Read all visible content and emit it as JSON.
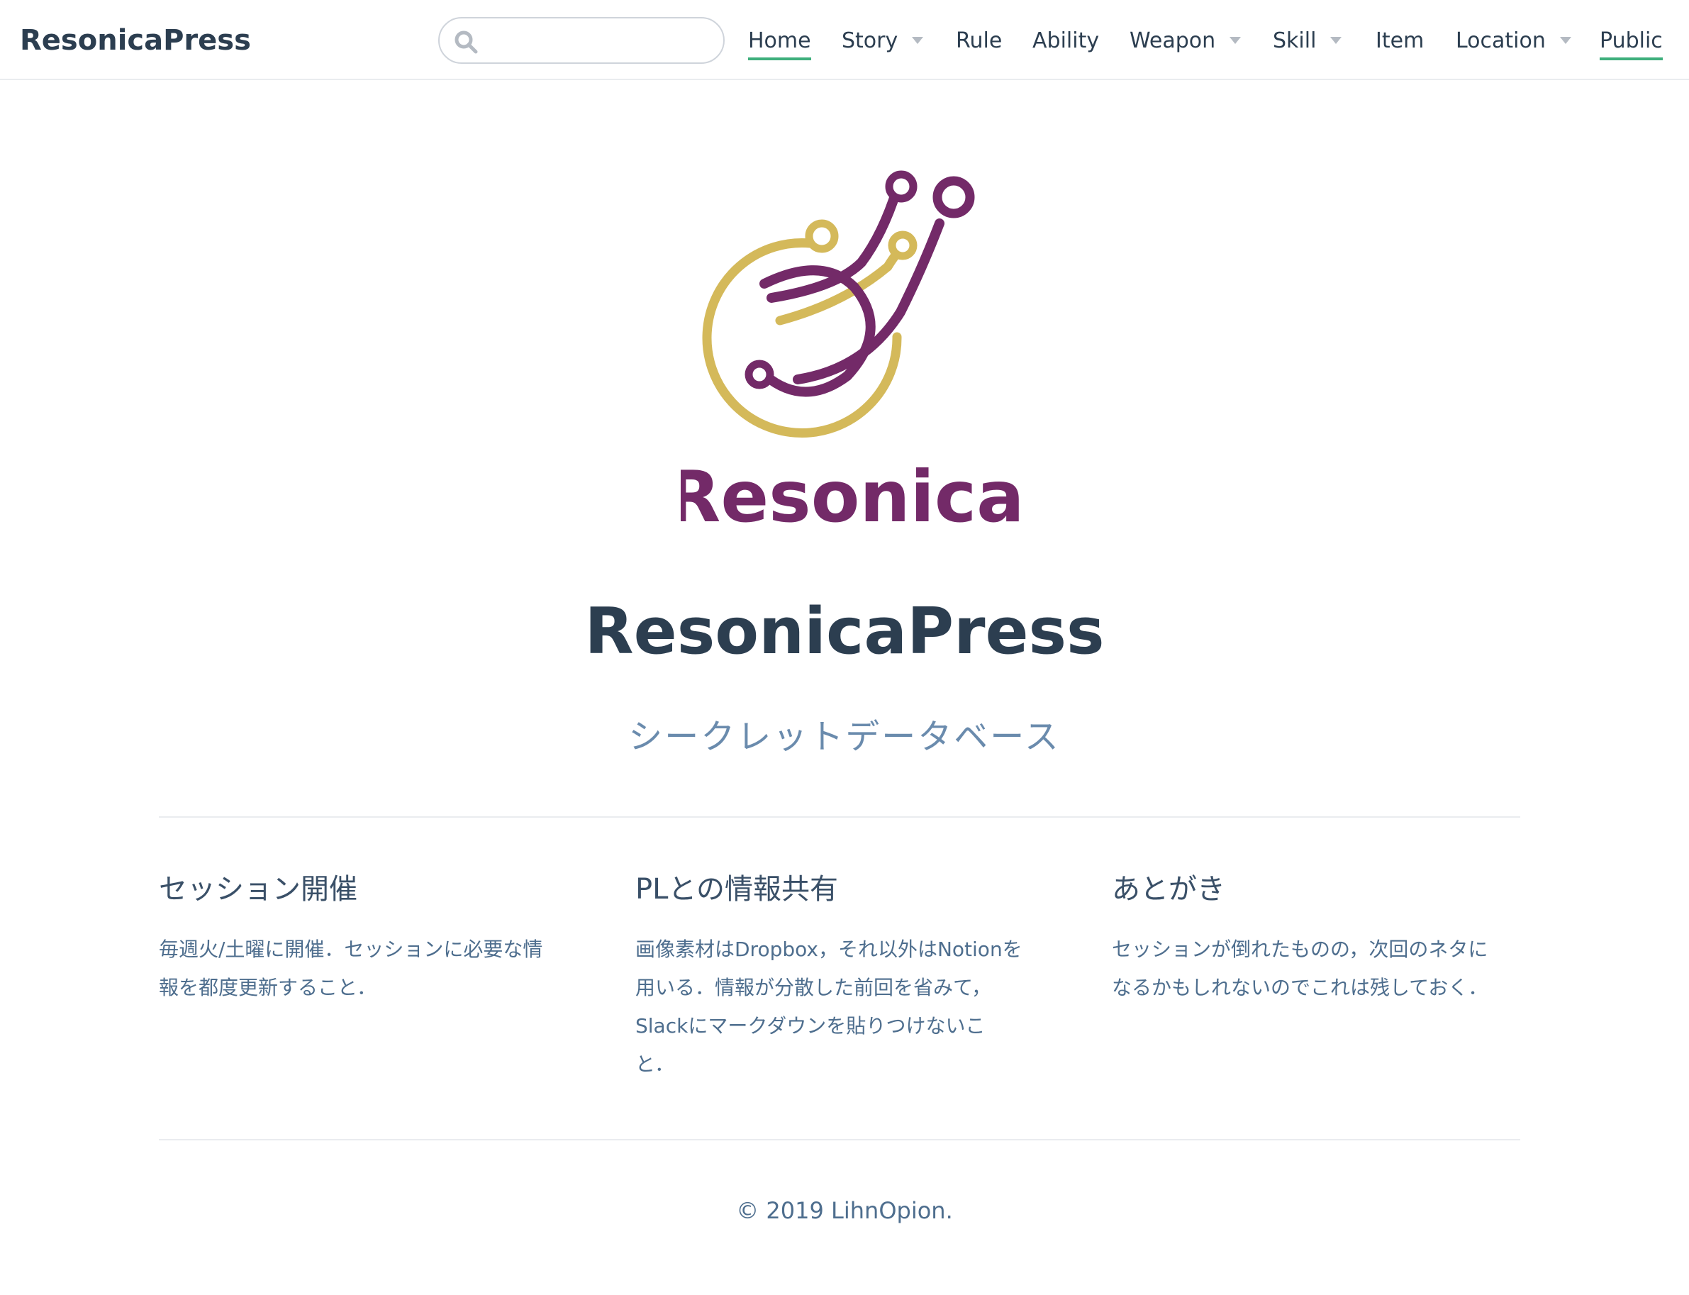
{
  "navbar": {
    "brand": "ResonicaPress",
    "search": {
      "placeholder": "",
      "value": "",
      "icon": "search-icon"
    },
    "items": [
      {
        "label": "Home",
        "dropdown": false,
        "active": true
      },
      {
        "label": "Story",
        "dropdown": true,
        "active": false
      },
      {
        "label": "Rule",
        "dropdown": false,
        "active": false
      },
      {
        "label": "Ability",
        "dropdown": false,
        "active": false
      },
      {
        "label": "Weapon",
        "dropdown": true,
        "active": false
      },
      {
        "label": "Skill",
        "dropdown": true,
        "active": false
      },
      {
        "label": "Item",
        "dropdown": false,
        "active": false
      },
      {
        "label": "Location",
        "dropdown": true,
        "active": false
      },
      {
        "label": "Public",
        "dropdown": false,
        "active": true
      }
    ]
  },
  "hero": {
    "logo_text": "Resonica",
    "title": "ResonicaPress",
    "subtitle": "シークレットデータベース"
  },
  "features": [
    {
      "title": "セッション開催",
      "lines": [
        "毎週火/土曜に開催．セッションに必要な情",
        "報を都度更新すること．"
      ]
    },
    {
      "title": "PLとの情報共有",
      "lines": [
        "画像素材はDropbox，それ以外はNotionを",
        "用いる．情報が分散した前回を省みて，",
        "Slackにマークダウンを貼りつけないこ",
        "と．"
      ]
    },
    {
      "title": "あとがき",
      "lines": [
        "セッションが倒れたものの，次回のネタに",
        "なるかもしれないのでこれは残しておく．"
      ]
    }
  ],
  "footer": {
    "text": "© 2019 LihnOpion."
  },
  "colors": {
    "accent": "#3eaf7c",
    "logo_purple": "#732a68",
    "logo_gold": "#d4b95a",
    "text": "#2c3e50"
  }
}
